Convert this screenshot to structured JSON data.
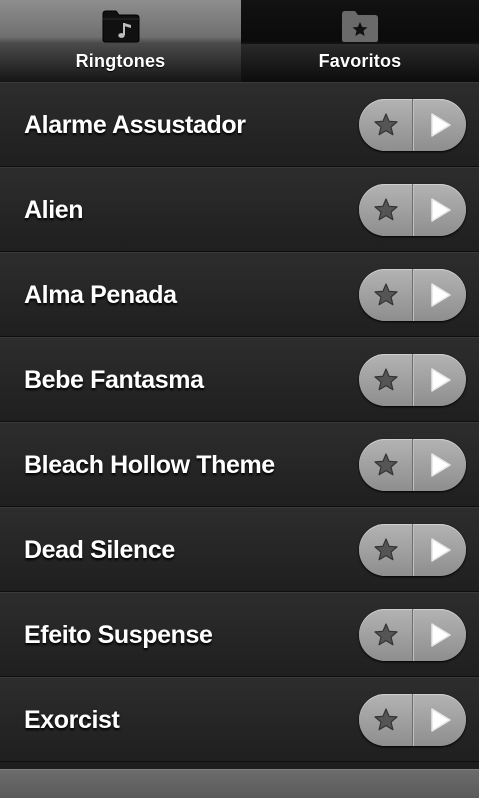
{
  "tabs": [
    {
      "label": "Ringtones",
      "icon": "music-folder-icon",
      "selected": true
    },
    {
      "label": "Favoritos",
      "icon": "star-folder-icon",
      "selected": false
    }
  ],
  "ringtones": [
    {
      "title": "Alarme Assustador"
    },
    {
      "title": "Alien"
    },
    {
      "title": "Alma Penada"
    },
    {
      "title": "Bebe Fantasma"
    },
    {
      "title": "Bleach Hollow Theme"
    },
    {
      "title": "Dead Silence"
    },
    {
      "title": "Efeito Suspense"
    },
    {
      "title": "Exorcist"
    }
  ],
  "row_controls": {
    "favorite_icon": "star-icon",
    "play_icon": "play-icon"
  },
  "colors": {
    "background": "#1e1e1e",
    "text": "#ffffff",
    "control": "#a0a0a0"
  }
}
